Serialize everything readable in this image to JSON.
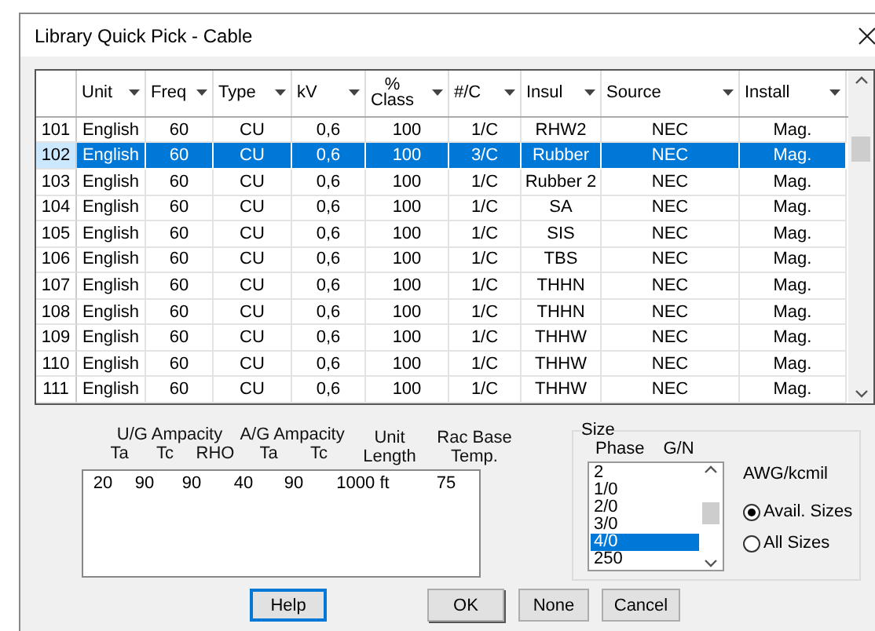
{
  "window": {
    "title": "Library Quick Pick - Cable"
  },
  "table": {
    "columns": [
      "Unit",
      "Freq",
      "Type",
      "kV",
      "%\nClass",
      "#/C",
      "Insul",
      "Source",
      "Install"
    ],
    "rows": [
      {
        "number": "101",
        "cells": [
          "English",
          "60",
          "CU",
          "0,6",
          "100",
          "1/C",
          "RHW2",
          "NEC",
          "Mag."
        ],
        "selected": false
      },
      {
        "number": "102",
        "cells": [
          "English",
          "60",
          "CU",
          "0,6",
          "100",
          "3/C",
          "Rubber",
          "NEC",
          "Mag."
        ],
        "selected": true
      },
      {
        "number": "103",
        "cells": [
          "English",
          "60",
          "CU",
          "0,6",
          "100",
          "1/C",
          "Rubber 2",
          "NEC",
          "Mag."
        ],
        "selected": false
      },
      {
        "number": "104",
        "cells": [
          "English",
          "60",
          "CU",
          "0,6",
          "100",
          "1/C",
          "SA",
          "NEC",
          "Mag."
        ],
        "selected": false
      },
      {
        "number": "105",
        "cells": [
          "English",
          "60",
          "CU",
          "0,6",
          "100",
          "1/C",
          "SIS",
          "NEC",
          "Mag."
        ],
        "selected": false
      },
      {
        "number": "106",
        "cells": [
          "English",
          "60",
          "CU",
          "0,6",
          "100",
          "1/C",
          "TBS",
          "NEC",
          "Mag."
        ],
        "selected": false
      },
      {
        "number": "107",
        "cells": [
          "English",
          "60",
          "CU",
          "0,6",
          "100",
          "1/C",
          "THHN",
          "NEC",
          "Mag."
        ],
        "selected": false
      },
      {
        "number": "108",
        "cells": [
          "English",
          "60",
          "CU",
          "0,6",
          "100",
          "1/C",
          "THHN",
          "NEC",
          "Mag."
        ],
        "selected": false
      },
      {
        "number": "109",
        "cells": [
          "English",
          "60",
          "CU",
          "0,6",
          "100",
          "1/C",
          "THHW",
          "NEC",
          "Mag."
        ],
        "selected": false
      },
      {
        "number": "110",
        "cells": [
          "English",
          "60",
          "CU",
          "0,6",
          "100",
          "1/C",
          "THHW",
          "NEC",
          "Mag."
        ],
        "selected": false
      },
      {
        "number": "111",
        "cells": [
          "English",
          "60",
          "CU",
          "0,6",
          "100",
          "1/C",
          "THHW",
          "NEC",
          "Mag."
        ],
        "selected": false
      }
    ]
  },
  "ampacity": {
    "groups": [
      {
        "label": "U/G Ampacity",
        "columns": [
          "Ta",
          "Tc",
          "RHO"
        ]
      },
      {
        "label": "A/G Ampacity",
        "columns": [
          "Ta",
          "Tc"
        ]
      }
    ],
    "extra_columns": [
      "Unit\nLength",
      "Rac Base\nTemp."
    ],
    "values": [
      "20",
      "90",
      "90",
      "40",
      "90",
      "1000 ft",
      "75"
    ]
  },
  "size": {
    "title": "Size",
    "list_headers": [
      "Phase",
      "G/N"
    ],
    "items": [
      {
        "label": "2",
        "selected": false
      },
      {
        "label": "1/0",
        "selected": false
      },
      {
        "label": "2/0",
        "selected": false
      },
      {
        "label": "3/0",
        "selected": false
      },
      {
        "label": "4/0",
        "selected": true
      },
      {
        "label": "250",
        "selected": false
      }
    ],
    "units_label": "AWG/kcmil",
    "options": [
      {
        "label": "Avail. Sizes",
        "selected": true
      },
      {
        "label": "All Sizes",
        "selected": false
      }
    ]
  },
  "buttons": [
    {
      "label": "Help",
      "kind": "focused"
    },
    {
      "label": "OK",
      "kind": "default"
    },
    {
      "label": "None",
      "kind": "normal"
    },
    {
      "label": "Cancel",
      "kind": "normal"
    }
  ]
}
